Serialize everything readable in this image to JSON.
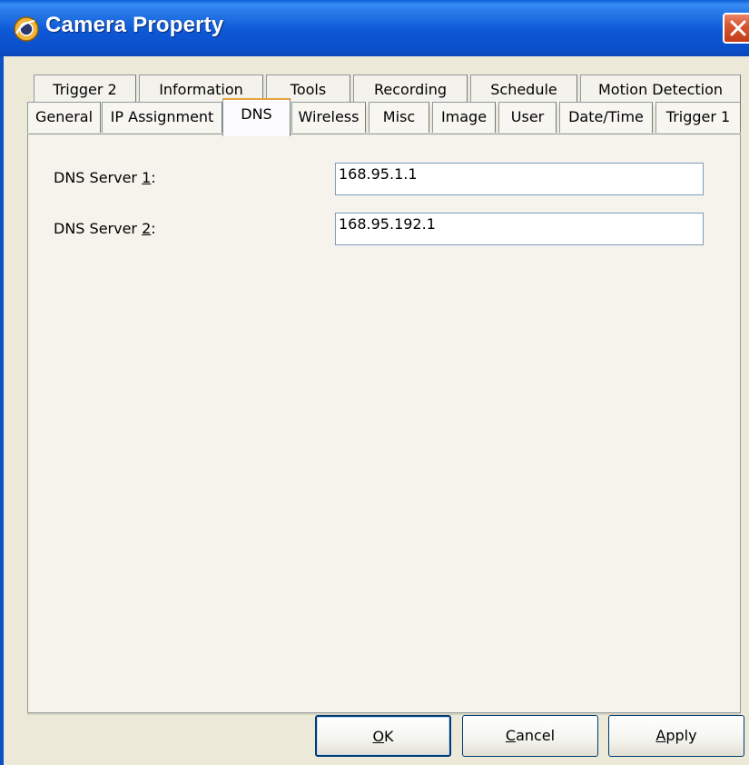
{
  "window": {
    "title": "Camera Property",
    "close_icon": "close-icon",
    "app_icon": "camera-property-icon"
  },
  "tabs": {
    "row1": [
      {
        "label": "Trigger 2"
      },
      {
        "label": "Information"
      },
      {
        "label": "Tools"
      },
      {
        "label": "Recording"
      },
      {
        "label": "Schedule"
      },
      {
        "label": "Motion Detection"
      }
    ],
    "row2": [
      {
        "label": "General"
      },
      {
        "label": "IP Assignment"
      },
      {
        "label": "DNS"
      },
      {
        "label": "Wireless"
      },
      {
        "label": "Misc"
      },
      {
        "label": "Image"
      },
      {
        "label": "User"
      },
      {
        "label": "Date/Time"
      },
      {
        "label": "Trigger 1"
      }
    ],
    "active": "DNS"
  },
  "dns": {
    "server1": {
      "label_pre": "DNS Server ",
      "label_key": "1",
      "label_post": ":",
      "value": "168.95.1.1"
    },
    "server2": {
      "label_pre": "DNS Server ",
      "label_key": "2",
      "label_post": ":",
      "value": "168.95.192.1"
    }
  },
  "buttons": {
    "ok": {
      "key": "O",
      "rest": "K"
    },
    "cancel": {
      "key": "C",
      "rest": "ancel"
    },
    "apply": {
      "key": "A",
      "rest": "pply"
    }
  },
  "colors": {
    "titlebar": "#0a5fd8",
    "dialog_bg": "#ece9d8",
    "active_tab_accent": "#e8a33e",
    "close_button": "#d8562f"
  }
}
